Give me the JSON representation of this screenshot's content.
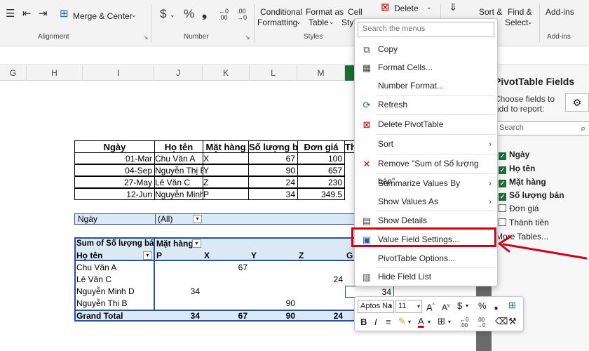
{
  "ribbon": {
    "merge_center": "Merge & Center",
    "currency_symbol": "$",
    "percent_symbol": "%",
    "comma_symbol": "❟",
    "cond_format_line1": "Conditional",
    "cond_format_line2": "Formatting",
    "format_table_line1": "Format as",
    "format_table_line2": "Table",
    "cell_styles_line1": "Cell",
    "cell_styles_line2": "Styles",
    "delete_label": "Delete",
    "sort_filter_line1": "Sort &",
    "find_select_line1": "Find &",
    "find_select_line2": "Select",
    "addins_label": "Add-ins",
    "group_alignment": "Alignment",
    "group_number": "Number",
    "group_styles": "Styles",
    "group_addins": "Add-ins"
  },
  "columns": [
    "G",
    "H",
    "I",
    "J",
    "K",
    "L",
    "M"
  ],
  "table": {
    "headers": [
      "Ngày",
      "Họ tên",
      "Mặt hàng",
      "Số lượng bán",
      "Đơn giá",
      "Th"
    ],
    "rows": [
      [
        "01-Mar",
        "Chu Văn A",
        "X",
        "67",
        "100"
      ],
      [
        "04-Sep",
        "Nguyễn Thị B",
        "Y",
        "90",
        "657"
      ],
      [
        "27-May",
        "Lê Văn C",
        "Z",
        "24",
        "230"
      ],
      [
        "12-Jun",
        "Nguyễn Minh",
        "P",
        "34",
        "349.5"
      ]
    ]
  },
  "pivot": {
    "filter_label": "Ngày",
    "filter_value": "(All)",
    "values_header": "Sum of Số lượng bán",
    "col_field": "Mặt hàng",
    "row_field": "Họ tên",
    "col_items": [
      "P",
      "X",
      "Y",
      "Z",
      "G"
    ],
    "rows": [
      {
        "name": "Chu Văn A",
        "vals": [
          "",
          "",
          "67",
          "",
          ""
        ]
      },
      {
        "name": "Lê Văn C",
        "vals": [
          "",
          "",
          "",
          "",
          "24"
        ]
      },
      {
        "name": "Nguyễn Minh D",
        "vals": [
          "34",
          "",
          "",
          "",
          ""
        ]
      },
      {
        "name": "Nguyễn Thị B",
        "vals": [
          "",
          "",
          "",
          "90",
          ""
        ]
      }
    ],
    "extra_val_34": "34",
    "grand_total_label": "Grand Total",
    "grand_total": [
      "34",
      "67",
      "90",
      "24"
    ]
  },
  "context_menu": {
    "search_placeholder": "Search the menus",
    "items": [
      {
        "label": "Copy",
        "icon": "copy-icon"
      },
      {
        "label": "Format Cells...",
        "icon": "format-cells-icon"
      },
      {
        "label": "Number Format...",
        "icon": ""
      },
      {
        "label": "Refresh",
        "icon": "refresh-icon"
      },
      {
        "label": "Delete PivotTable",
        "icon": "delete-pivot-icon"
      },
      {
        "label": "Sort",
        "icon": ""
      },
      {
        "label": "Remove \"Sum of Số lượng bán\"",
        "icon": "remove-x-icon"
      },
      {
        "label": "Summarize Values By",
        "icon": ""
      },
      {
        "label": "Show Values As",
        "icon": ""
      },
      {
        "label": "Show Details",
        "icon": "show-details-icon"
      },
      {
        "label": "Value Field Settings...",
        "icon": "value-field-settings-icon"
      },
      {
        "label": "PivotTable Options...",
        "icon": ""
      },
      {
        "label": "Hide Field List",
        "icon": "hide-field-list-icon"
      }
    ]
  },
  "pivot_pane": {
    "title": "PivotTable Fields",
    "subtitle_line1": "Choose fields to",
    "subtitle_line2": "add to report:",
    "search_placeholder": "Search",
    "fields": [
      {
        "label": "Ngày",
        "checked": true
      },
      {
        "label": "Họ tên",
        "checked": true
      },
      {
        "label": "Mặt hàng",
        "checked": true
      },
      {
        "label": "Số lượng bán",
        "checked": true
      },
      {
        "label": "Đơn giá",
        "checked": false
      },
      {
        "label": "Thành tiền",
        "checked": false
      }
    ],
    "more_tables": "More Tables..."
  },
  "mini_toolbar": {
    "font_name": "Aptos Na",
    "font_size": "11"
  },
  "colors": {
    "highlight_red": "#d0021b",
    "pivot_blue": "#dbe8f5",
    "excel_green": "#1e6e36"
  }
}
